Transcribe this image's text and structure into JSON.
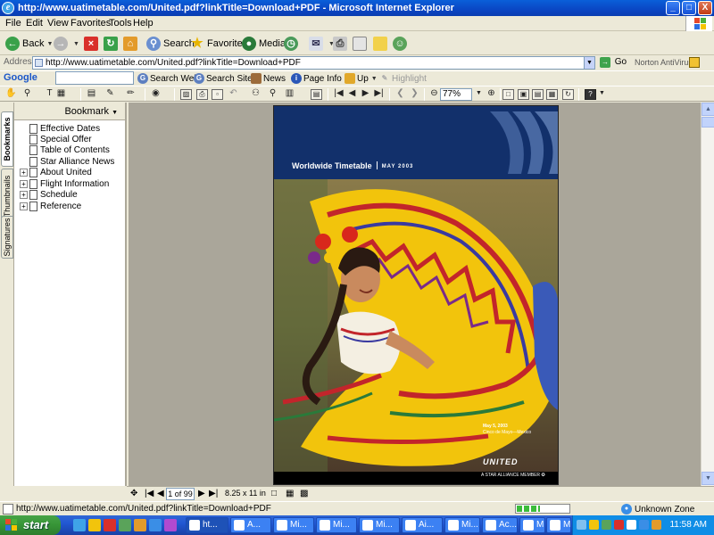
{
  "window": {
    "title": "http://www.uatimetable.com/United.pdf?linkTitle=Download+PDF - Microsoft Internet Explorer",
    "min_glyph": "_",
    "max_glyph": "□",
    "close_glyph": "X"
  },
  "menu": [
    "File",
    "Edit",
    "View",
    "Favorites",
    "Tools",
    "Help"
  ],
  "toolbar": {
    "back": "Back",
    "search": "Search",
    "favorites": "Favorites",
    "media": "Media"
  },
  "address": {
    "label": "Address",
    "url": "http://www.uatimetable.com/United.pdf?linkTitle=Download+PDF",
    "go": "Go",
    "norton": "Norton AntiVirus"
  },
  "google": {
    "logo": "Google",
    "search_web": "Search Web",
    "search_site": "Search Site",
    "news": "News",
    "page_info": "Page Info",
    "up": "Up",
    "highlight": "Highlight"
  },
  "acrobat": {
    "zoom": "77%"
  },
  "navtabs": [
    "Bookmarks",
    "Thumbnails",
    "Signatures"
  ],
  "bookmarks": {
    "header": "Bookmark",
    "items": [
      {
        "label": "Effective Dates",
        "expandable": false
      },
      {
        "label": "Special Offer",
        "expandable": false
      },
      {
        "label": "Table of Contents",
        "expandable": false
      },
      {
        "label": "Star Alliance News",
        "expandable": false
      },
      {
        "label": "About United",
        "expandable": true
      },
      {
        "label": "Flight Information",
        "expandable": true
      },
      {
        "label": "Schedule",
        "expandable": true
      },
      {
        "label": "Reference",
        "expandable": true
      }
    ]
  },
  "pdf": {
    "title": "Worldwide Timetable",
    "month": "MAY 2003",
    "caption_date": "May 5, 2003",
    "caption_event": "Cinco de Mayo—Mexico",
    "brand": "UNITED",
    "alliance": "A STAR ALLIANCE MEMBER"
  },
  "pdfstatus": {
    "page": "1 of 99",
    "size": "8.25 x 11 in"
  },
  "status": {
    "text": "http://www.uatimetable.com/United.pdf?linkTitle=Download+PDF",
    "zone": "Unknown Zone",
    "progress": 0.45
  },
  "taskbar": {
    "start": "start",
    "tasks": [
      "ht...",
      "A...",
      "Mi...",
      "Mi...",
      "Mi...",
      "Ai...",
      "Mi...",
      "Ac...",
      "Mi...",
      "Mi..."
    ],
    "clock": "11:58 AM"
  },
  "colors": {
    "titlebar": "#0a46c4",
    "pdf_blue": "#12306b",
    "skirt_yellow": "#f2c40c",
    "taskbar": "#2157d3"
  }
}
